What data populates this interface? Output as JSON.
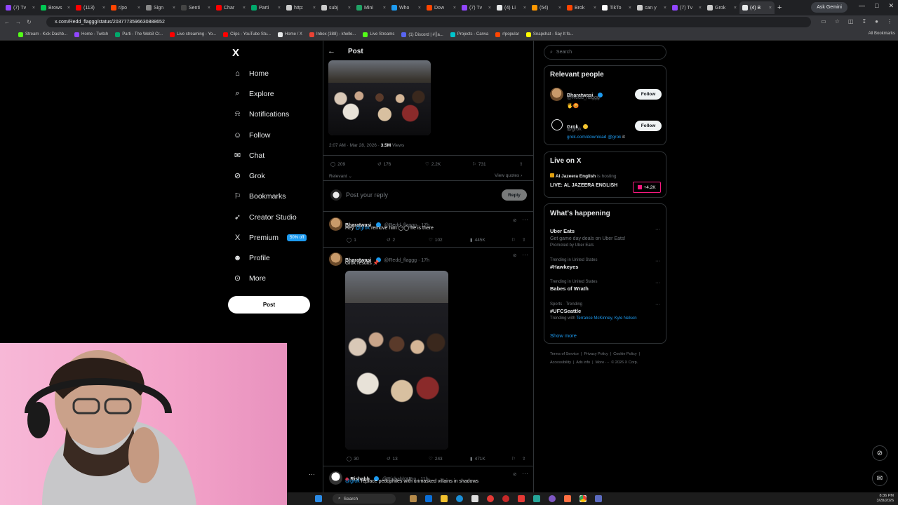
{
  "browser": {
    "tabs": [
      {
        "label": "(7) Tv",
        "color": "#9146ff"
      },
      {
        "label": "Brows",
        "color": "#00c853"
      },
      {
        "label": "(113)",
        "color": "#ff0000"
      },
      {
        "label": "r/po",
        "color": "#ff4500"
      },
      {
        "label": "Sign",
        "color": "#888888"
      },
      {
        "label": "Senti",
        "color": "#444444"
      },
      {
        "label": "Char",
        "color": "#ff0000"
      },
      {
        "label": "Parti",
        "color": "#00a86b"
      },
      {
        "label": "http:",
        "color": "#cccccc"
      },
      {
        "label": "subj",
        "color": "#cccccc"
      },
      {
        "label": "Mini",
        "color": "#21a366"
      },
      {
        "label": "Who",
        "color": "#1d9bf0"
      },
      {
        "label": "Dow",
        "color": "#ff4500"
      },
      {
        "label": "(7) Tv",
        "color": "#9146ff"
      },
      {
        "label": "(4) Li",
        "color": "#e7e9ea"
      },
      {
        "label": "(54)",
        "color": "#ff9800"
      },
      {
        "label": "Brok",
        "color": "#ff4500"
      },
      {
        "label": "TikTo",
        "color": "#ffffff"
      },
      {
        "label": "can y",
        "color": "#cccccc"
      },
      {
        "label": "(7) Tv",
        "color": "#9146ff"
      },
      {
        "label": "Grok",
        "color": "#cccccc"
      },
      {
        "label": "(4) B",
        "color": "#e7e9ea"
      }
    ],
    "active_tab_index": 21,
    "ask_gemini": "Ask Gemini",
    "url": "x.com/Redd_flaggg/status/2037773596630888652",
    "bookmarks": [
      {
        "label": "Stream - Kick Dashb...",
        "color": "#53fc18"
      },
      {
        "label": "Home - Twitch",
        "color": "#9146ff"
      },
      {
        "label": "Parti - The Web3 Cr...",
        "color": "#00a86b"
      },
      {
        "label": "Live streaming - Yo...",
        "color": "#ff0000"
      },
      {
        "label": "Clips - YouTube Stu...",
        "color": "#ff0000"
      },
      {
        "label": "Home / X",
        "color": "#e7e9ea"
      },
      {
        "label": "Inbox (388) - khelle...",
        "color": "#ea4335"
      },
      {
        "label": "Live Streams",
        "color": "#53fc18"
      },
      {
        "label": "(1) Discord | #┃a...",
        "color": "#5865f2"
      },
      {
        "label": "Projects - Canva",
        "color": "#00c4cc"
      },
      {
        "label": "r/popular",
        "color": "#ff4500"
      },
      {
        "label": "Snapchat - Say It fo...",
        "color": "#fffc00"
      }
    ],
    "all_bookmarks": "All Bookmarks"
  },
  "nav": {
    "items": [
      {
        "label": "Home",
        "icon": "⌂"
      },
      {
        "label": "Explore",
        "icon": "⌕"
      },
      {
        "label": "Notifications",
        "icon": "⍾"
      },
      {
        "label": "Follow",
        "icon": "☺"
      },
      {
        "label": "Chat",
        "icon": "✉"
      },
      {
        "label": "Grok",
        "icon": "⊘"
      },
      {
        "label": "Bookmarks",
        "icon": "⚐"
      },
      {
        "label": "Creator Studio",
        "icon": "➶"
      },
      {
        "label": "Premium",
        "icon": "X"
      },
      {
        "label": "Profile",
        "icon": "☻"
      },
      {
        "label": "More",
        "icon": "⊙"
      }
    ],
    "premium_badge": "50% off",
    "post_button": "Post"
  },
  "post": {
    "header": "Post",
    "timestamp": "2:07 AM · Mar 28, 2026 · ",
    "views": "3.5M",
    "views_label": "Views",
    "replies": "209",
    "reposts": "176",
    "likes": "2.2K",
    "bookmarks": "731",
    "sort": "Relevant",
    "view_quotes": "View quotes",
    "reply_placeholder": "Post your reply",
    "reply_button": "Reply"
  },
  "replies": [
    {
      "name": "Bharatwasi",
      "handle": "@Redd_flaggg · 17h",
      "text_before": "Hey ",
      "mention": "@grok",
      "text_after": " remove him ◯◯ he is there",
      "replies": "1",
      "reposts": "2",
      "likes": "102",
      "views": "445K"
    },
    {
      "name": "Bharatwasi",
      "handle": "@Redd_flaggg · 17h",
      "text_before": "Grok results 📌",
      "mention": "",
      "text_after": "",
      "replies": "30",
      "reposts": "13",
      "likes": "243",
      "views": "471K"
    },
    {
      "name": "Rishabh",
      "handle": "@RishabhXPro · 11h",
      "text_before": "",
      "mention": "@grok",
      "text_after": " replace pedophiles with unmasked villains in shadows",
      "replies": "",
      "reposts": "",
      "likes": "",
      "views": ""
    }
  ],
  "sidebar": {
    "search_placeholder": "Search",
    "relevant_title": "Relevant people",
    "people": [
      {
        "name": "Bharatwasi",
        "handle": "@Redd_flaggg",
        "bio": "🖐😡",
        "follow": "Follow"
      },
      {
        "name": "Grok",
        "handle": "@grok",
        "bio_link": "grok.com/download",
        "bio_mention": "@grok",
        "bio_tail": " it",
        "follow": "Follow"
      }
    ],
    "live_title": "Live on X",
    "live_source": "Al Jazeera English",
    "live_source_tail": "is hosting",
    "live_headline": "LIVE: AL JAZEERA ENGLISH",
    "live_count": "+4.2K",
    "happening_title": "What's happening",
    "trends": [
      {
        "title": "Uber Eats",
        "sub": "Get game day deals on Uber Eats!",
        "meta": "Promoted by Uber Eats"
      },
      {
        "meta": "Trending in United States",
        "title": "#Hawkeyes"
      },
      {
        "meta": "Trending in United States",
        "title": "Babes of Wrath"
      },
      {
        "meta": "Sports · Trending",
        "title": "#UFCSeattle",
        "with": "Trending with ",
        "with_names": "Terrance McKinney, Kyle Nelson"
      }
    ],
    "show_more": "Show more",
    "footer1": "Terms of Service  |  Privacy Policy  |  Cookie Policy  |",
    "footer2": "Accessibility  |  Ads info  |  More ···  © 2026 X Corp."
  },
  "taskbar": {
    "search": "Search",
    "time": "8:36 PM",
    "date": "3/28/2026"
  }
}
